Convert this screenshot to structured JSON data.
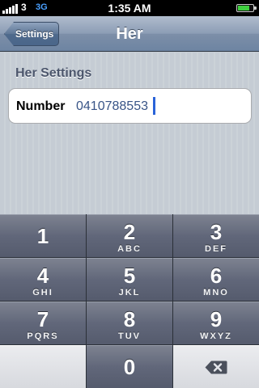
{
  "status_bar": {
    "signal_icon": "signal-bars-icon",
    "carrier": "3",
    "network": "3G",
    "time": "1:35 AM",
    "battery_icon": "battery-charging-icon",
    "battery_level": 0.8
  },
  "nav": {
    "back_label": "Settings",
    "title": "Her"
  },
  "section": {
    "header": "Her Settings"
  },
  "field": {
    "label": "Number",
    "value": "0410788553"
  },
  "keypad": {
    "keys": [
      {
        "digit": "1",
        "letters": ""
      },
      {
        "digit": "2",
        "letters": "ABC"
      },
      {
        "digit": "3",
        "letters": "DEF"
      },
      {
        "digit": "4",
        "letters": "GHI"
      },
      {
        "digit": "5",
        "letters": "JKL"
      },
      {
        "digit": "6",
        "letters": "MNO"
      },
      {
        "digit": "7",
        "letters": "PQRS"
      },
      {
        "digit": "8",
        "letters": "TUV"
      },
      {
        "digit": "9",
        "letters": "WXYZ"
      },
      {
        "digit": "0",
        "letters": ""
      }
    ],
    "delete_icon": "backspace-icon"
  },
  "colors": {
    "nav_bar": "#6d84a2",
    "field_value": "#385487",
    "caret": "#2a63d8",
    "keypad_dark": "#555b6d",
    "keypad_light": "#d7d9de"
  }
}
